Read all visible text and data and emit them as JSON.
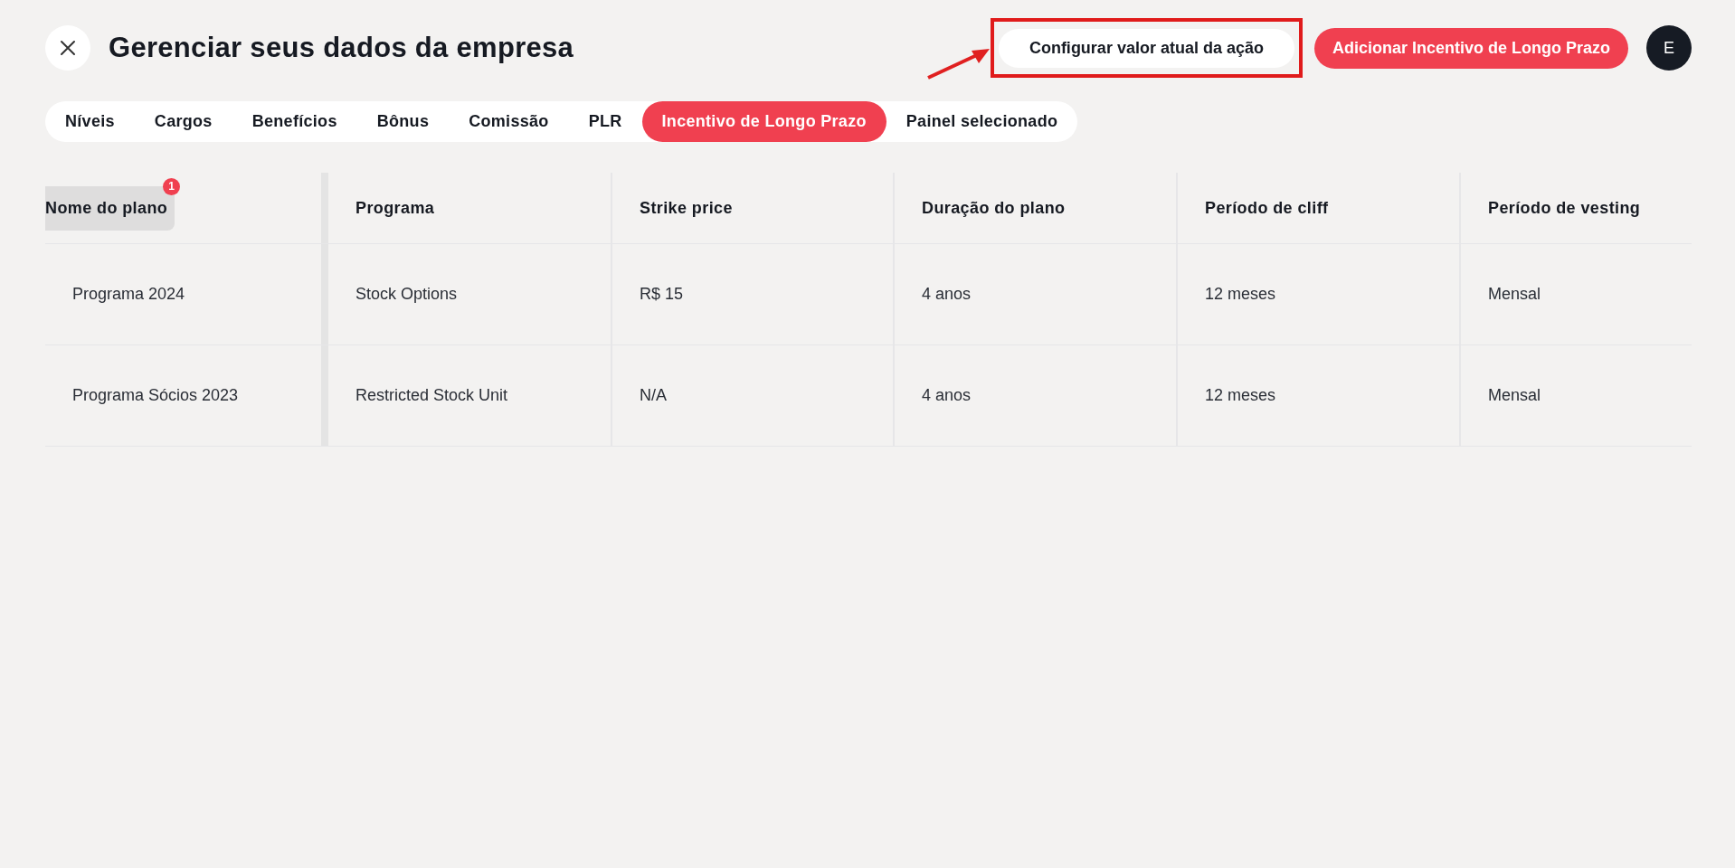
{
  "header": {
    "title": "Gerenciar seus dados da empresa",
    "secondary_button": "Configurar valor atual da ação",
    "primary_button": "Adicionar Incentivo de Longo Prazo",
    "avatar": "E"
  },
  "tabs": [
    {
      "label": "Níveis",
      "selected": false
    },
    {
      "label": "Cargos",
      "selected": false
    },
    {
      "label": "Benefícios",
      "selected": false
    },
    {
      "label": "Bônus",
      "selected": false
    },
    {
      "label": "Comissão",
      "selected": false
    },
    {
      "label": "PLR",
      "selected": false
    },
    {
      "label": "Incentivo de Longo Prazo",
      "selected": true
    },
    {
      "label": "Painel selecionado",
      "selected": false
    }
  ],
  "table": {
    "columns": [
      {
        "label": "Nome do plano",
        "highlighted": true,
        "badge": "1"
      },
      {
        "label": "Programa",
        "highlighted": false
      },
      {
        "label": "Strike price",
        "highlighted": false
      },
      {
        "label": "Duração do plano",
        "highlighted": false
      },
      {
        "label": "Período de cliff",
        "highlighted": false
      },
      {
        "label": "Período de vesting",
        "highlighted": false
      }
    ],
    "rows": [
      [
        "Programa 2024",
        "Stock Options",
        "R$ 15",
        "4 anos",
        "12 meses",
        "Mensal"
      ],
      [
        "Programa Sócios 2023",
        "Restricted Stock Unit",
        "N/A",
        "4 anos",
        "12 meses",
        "Mensal"
      ]
    ]
  }
}
